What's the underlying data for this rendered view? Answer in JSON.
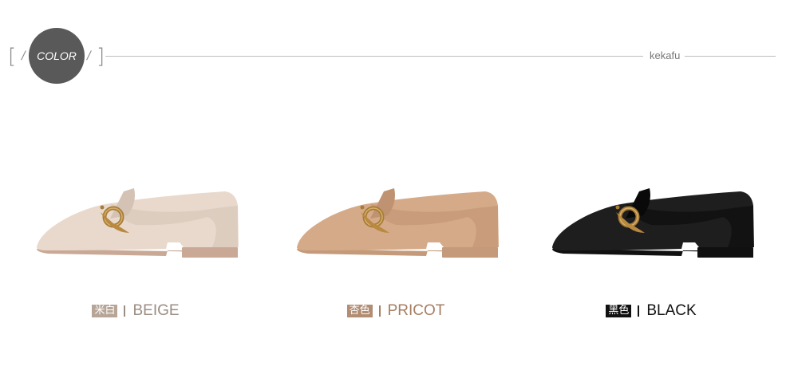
{
  "header": {
    "badge_label": "COLOR",
    "brand": "kekafu"
  },
  "products": [
    {
      "tag": "米白",
      "name": "BEIGE",
      "tag_color": "#b7a597",
      "name_color": "#9b8d82",
      "upper_color": "#e9d9cd",
      "upper_shadow": "#d4c2b4",
      "sole_color": "#c9a995"
    },
    {
      "tag": "杏色",
      "name": "PRICOT",
      "tag_color": "#b28d73",
      "name_color": "#a57e63",
      "upper_color": "#d5aa88",
      "upper_shadow": "#bf9271",
      "sole_color": "#c49a7a"
    },
    {
      "tag": "黑色",
      "name": "BLACK",
      "tag_color": "#111111",
      "name_color": "#111111",
      "upper_color": "#1e1e1e",
      "upper_shadow": "#090909",
      "sole_color": "#101010"
    }
  ]
}
